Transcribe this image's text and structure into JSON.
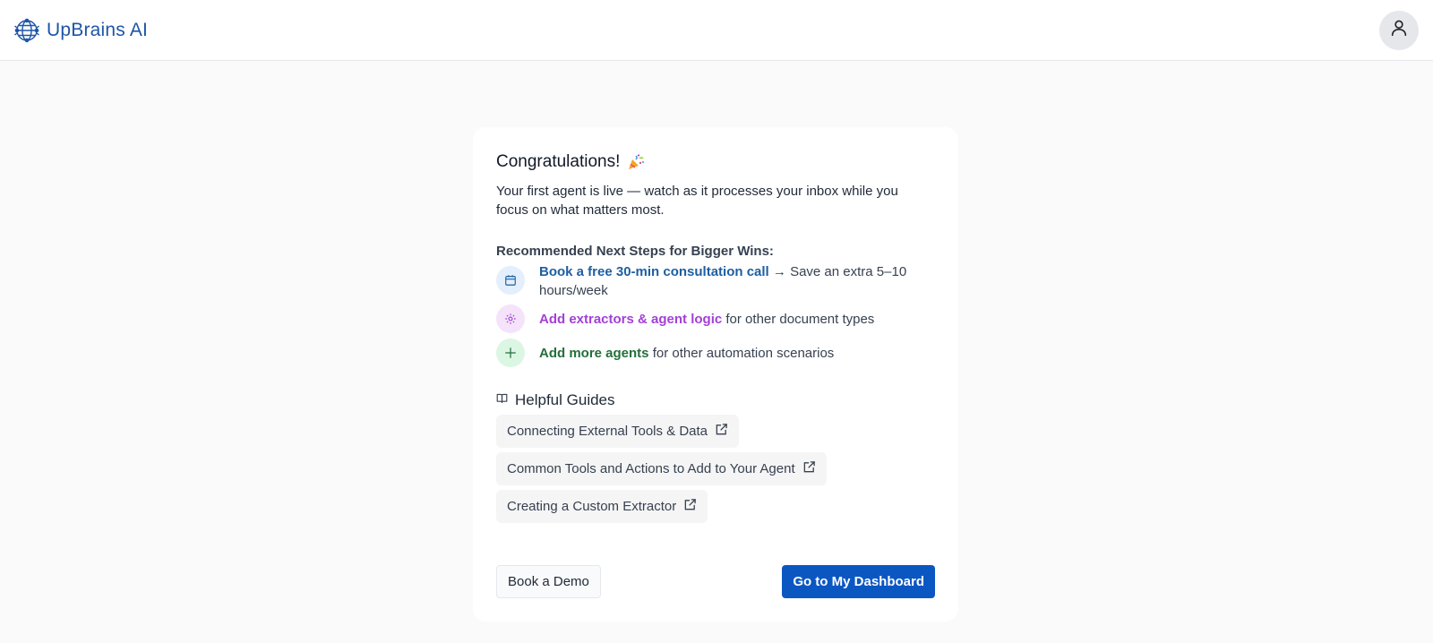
{
  "header": {
    "brand_name": "UpBrains AI",
    "logo_icon": "brain-globe-icon",
    "avatar_icon": "user-icon"
  },
  "card": {
    "title": "Congratulations!",
    "title_emoji": "party-popper-icon",
    "subtitle": "Your first agent is live — watch as it processes your inbox while you focus on what matters most.",
    "steps_heading": "Recommended Next Steps for Bigger Wins:",
    "steps": [
      {
        "icon": "calendar-icon",
        "link": "Book a free 30-min consultation call",
        "rest": " → Save an extra 5–10 hours/week",
        "color": "#1d5fa3",
        "bg": "#e3effc"
      },
      {
        "icon": "gear-icon",
        "link": "Add extractors & agent logic",
        "rest": " for other document types",
        "color": "#a340d6",
        "bg": "#f4e3fb"
      },
      {
        "icon": "plus-icon",
        "link": "Add more agents",
        "rest": " for other automation scenarios",
        "color": "#22703a",
        "bg": "#dcf6e4"
      }
    ],
    "guides_heading": "Helpful Guides",
    "guides_icon": "book-open-icon",
    "guides": [
      "Connecting External Tools & Data",
      "Common Tools and Actions to Add to Your Agent",
      "Creating a Custom Extractor"
    ],
    "secondary_button": "Book a Demo",
    "primary_button": "Go to My Dashboard"
  },
  "colors": {
    "brand": "#1d55a8",
    "primary_button": "#0b57c2",
    "background": "#fafafa"
  }
}
